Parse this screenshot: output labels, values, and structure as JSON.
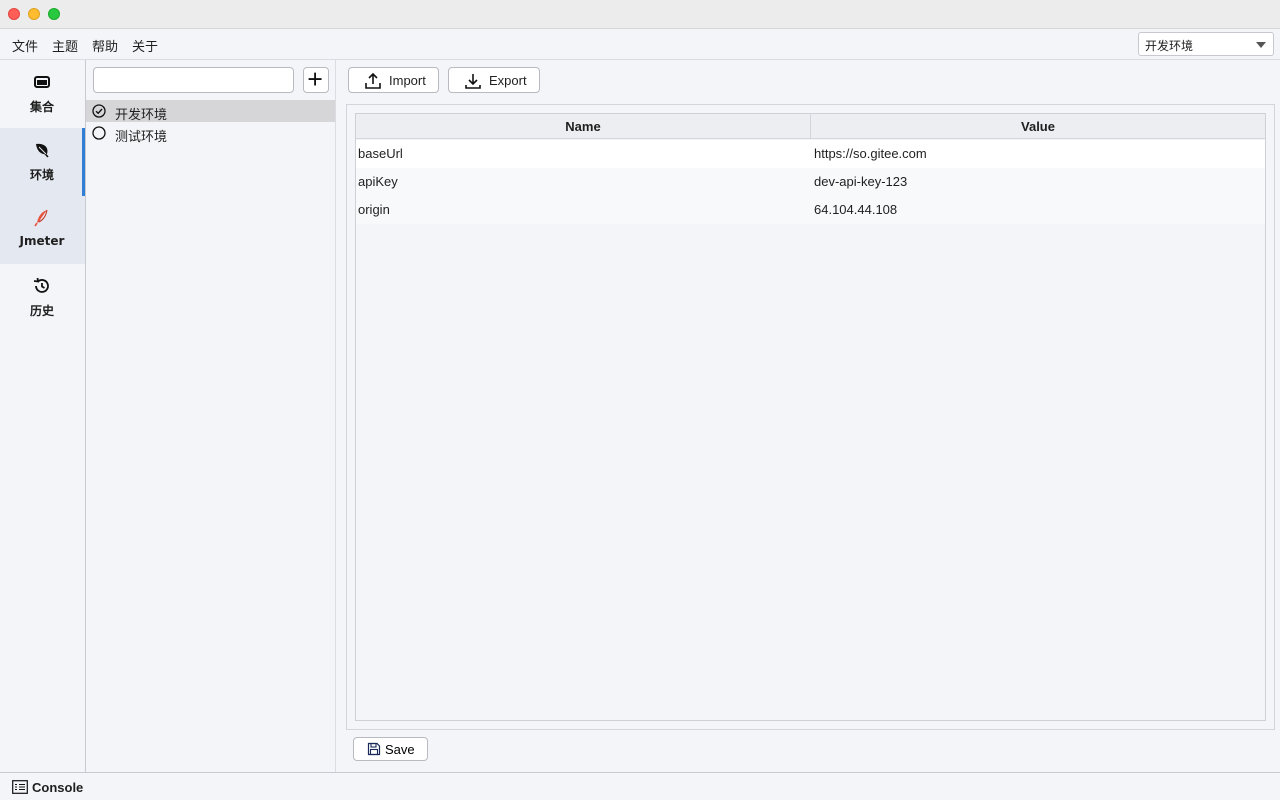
{
  "menu": {
    "items": [
      "文件",
      "主题",
      "帮助",
      "关于"
    ],
    "env_selector": {
      "value": "开发环境"
    }
  },
  "nav": {
    "items": [
      {
        "label": "集合",
        "icon": "collection-icon"
      },
      {
        "label": "环境",
        "icon": "leaf-icon"
      },
      {
        "label": "Jmeter",
        "icon": "feather-icon"
      },
      {
        "label": "历史",
        "icon": "history-icon"
      }
    ],
    "active_index": 1
  },
  "env_list": {
    "search": {
      "value": "",
      "placeholder": ""
    },
    "items": [
      {
        "name": "开发环境",
        "selected": true
      },
      {
        "name": "测试环境",
        "selected": false
      }
    ]
  },
  "toolbar": {
    "import_label": "Import",
    "export_label": "Export"
  },
  "table": {
    "columns": [
      "Name",
      "Value"
    ],
    "rows": [
      {
        "name": "baseUrl",
        "value": "https://so.gitee.com"
      },
      {
        "name": "apiKey",
        "value": "dev-api-key-123"
      },
      {
        "name": "origin",
        "value": "64.104.44.108"
      }
    ]
  },
  "footer": {
    "save_label": "Save",
    "console_label": "Console"
  },
  "colors": {
    "accent": "#2f7fd6",
    "feather": "#e8543f"
  }
}
